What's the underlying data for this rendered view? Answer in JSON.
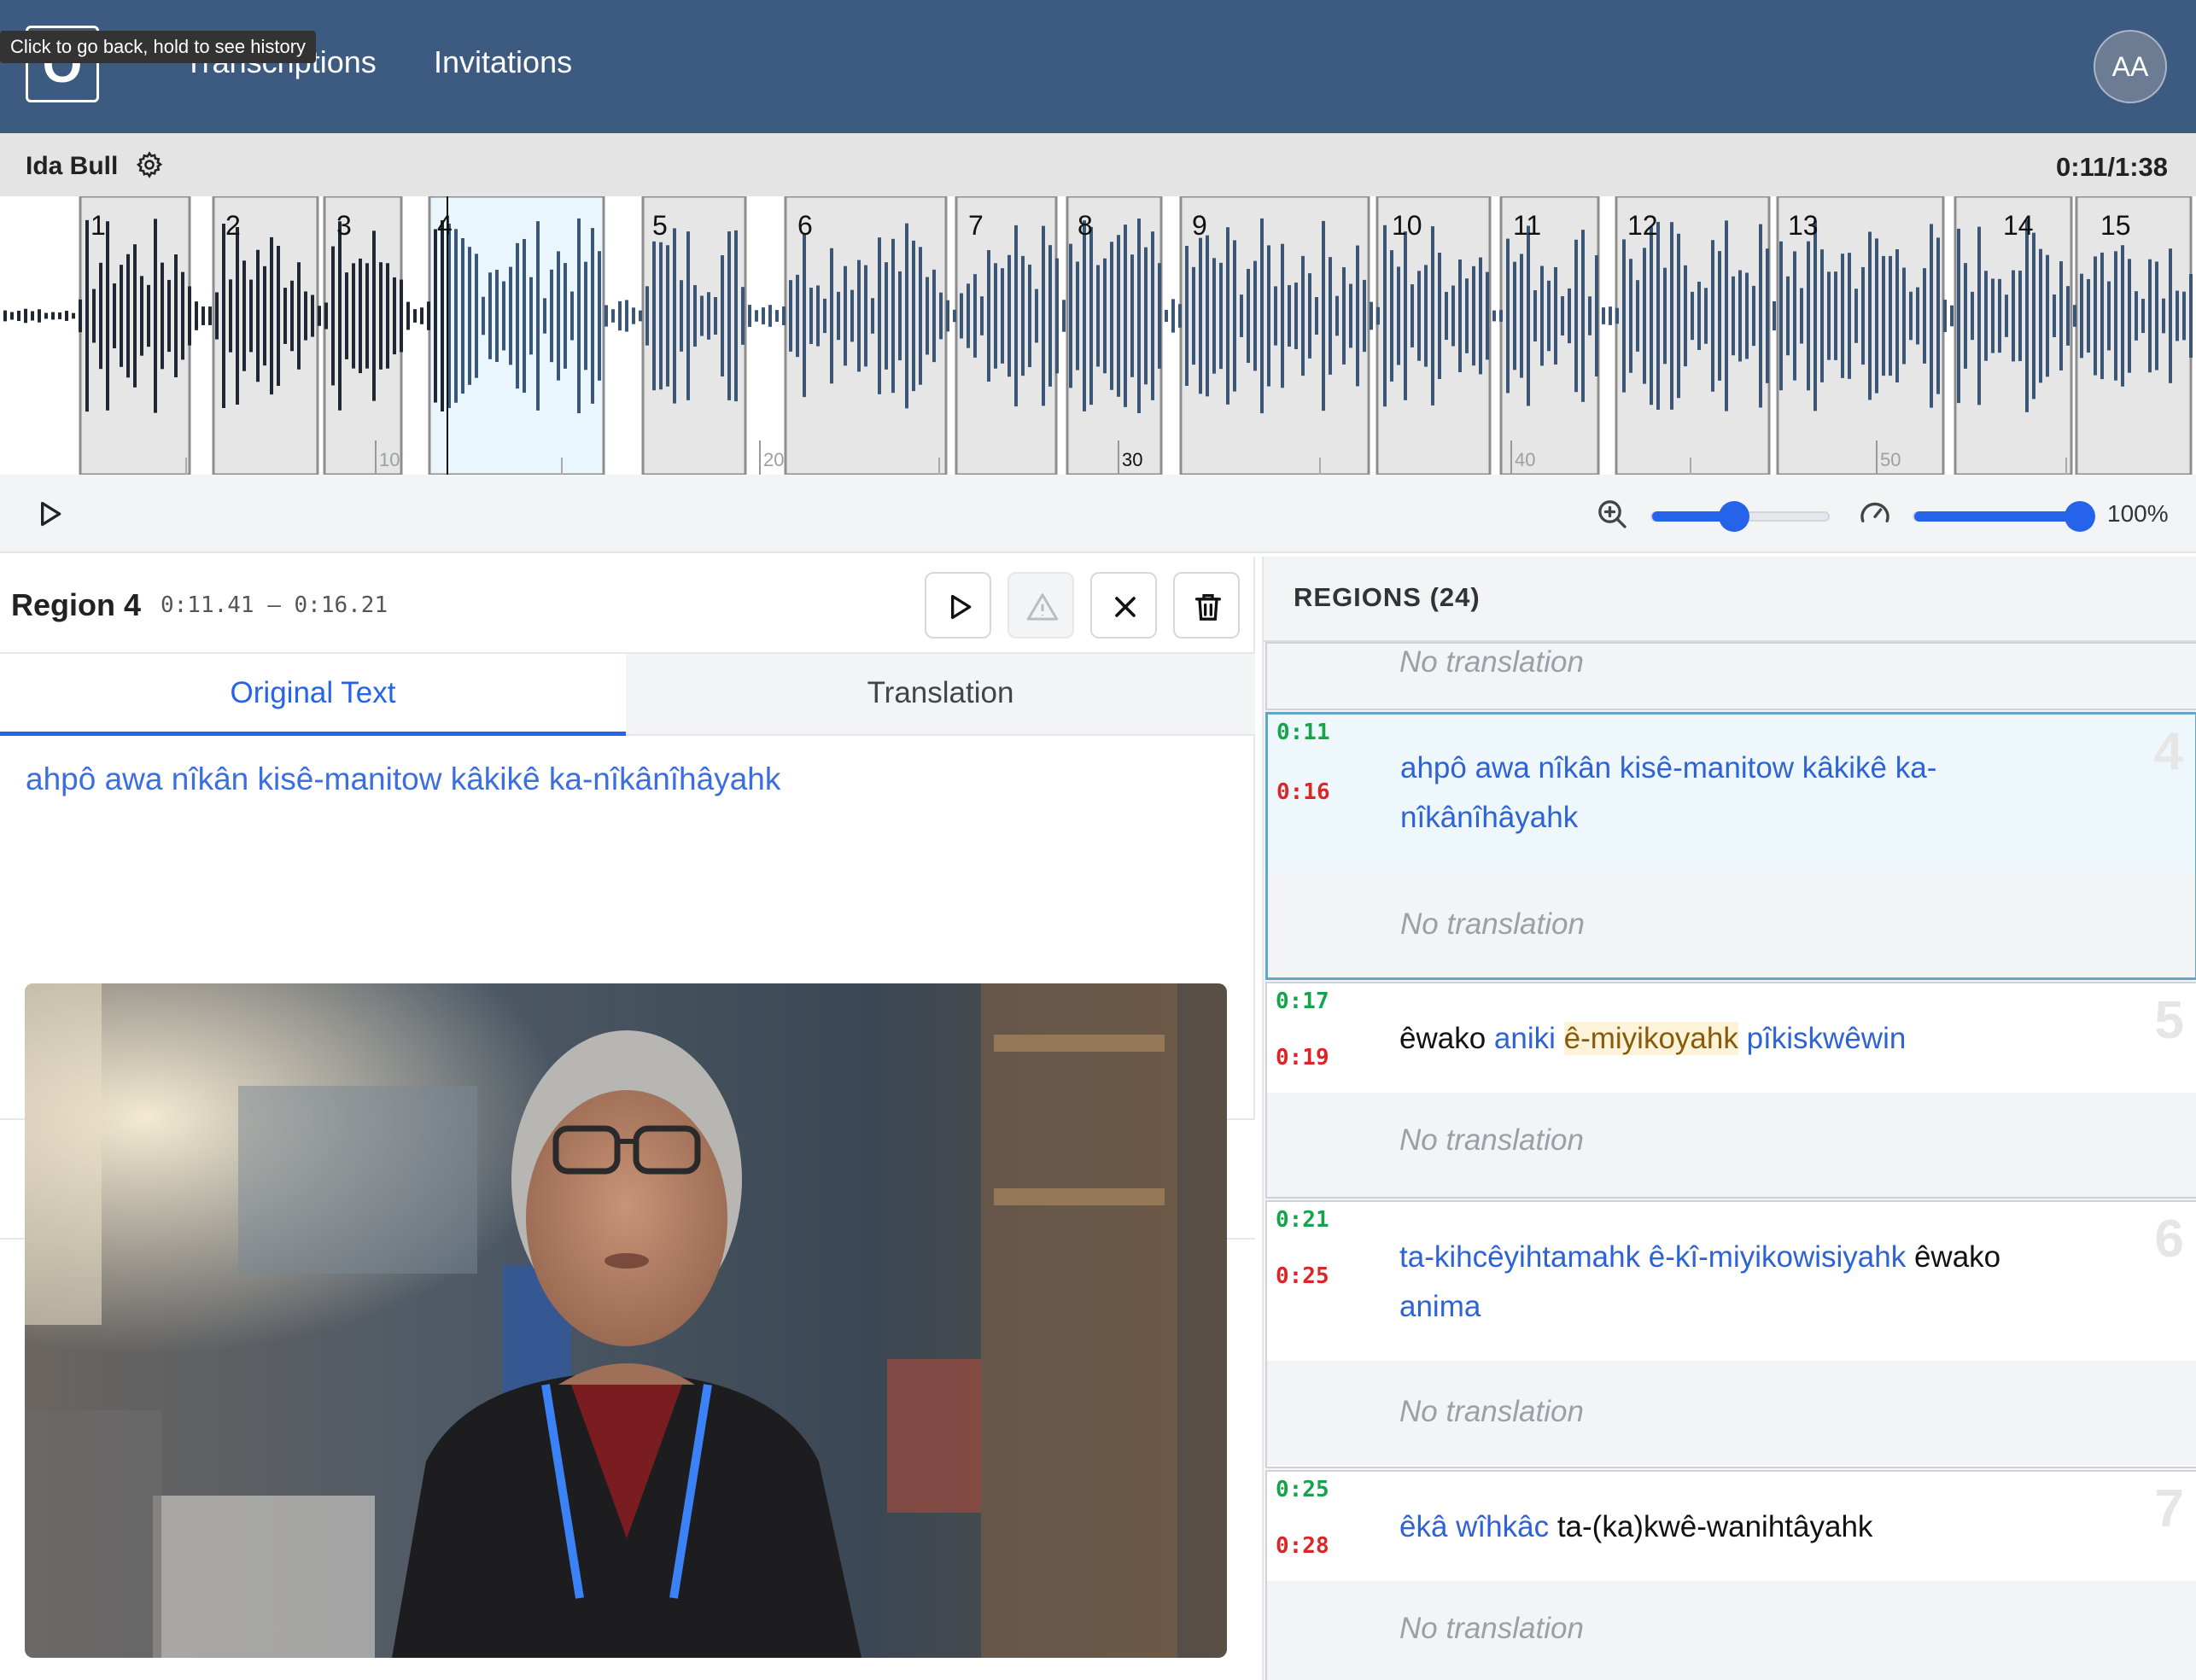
{
  "nav": {
    "logo": "O",
    "links": [
      "Transcriptions",
      "Invitations"
    ],
    "tooltip": "Click to go back, hold to see history",
    "avatar": "AA"
  },
  "info": {
    "speaker": "Ida Bull",
    "time": "0:11/1:38"
  },
  "waveform": {
    "region_numbers": [
      "1",
      "2",
      "3",
      "4",
      "5",
      "6",
      "7",
      "8",
      "9",
      "10",
      "11",
      "12",
      "13",
      "14",
      "15"
    ],
    "time_ticks": [
      "10",
      "20",
      "30",
      "40",
      "50"
    ]
  },
  "controls": {
    "zoom_level": 0.45,
    "speed_value": "100%"
  },
  "editor": {
    "region_title": "Region 4",
    "region_range": "0:11.41 – 0:16.21",
    "tabs": [
      "Original Text",
      "Translation"
    ],
    "original_text": "ahpô awa nîkân kisê-manitow kâkikê ka-nîkânîhâyahk"
  },
  "regions": {
    "title": "REGIONS (24)",
    "partial_translation": "No translation",
    "items": [
      {
        "start": "0:11",
        "end": "0:16",
        "num": "4",
        "line1": "ahpô awa nîkân kisê-manitow kâkikê ka-",
        "line2": "nîkânîhâyahk",
        "translation": "No translation"
      },
      {
        "start": "0:17",
        "end": "0:19",
        "num": "5",
        "w1": "êwako",
        "w2": "aniki",
        "w3": "ê-miyikoyahk",
        "w4": "pîkiskwêwin",
        "translation": "No translation"
      },
      {
        "start": "0:21",
        "end": "0:25",
        "num": "6",
        "w1": "ta-kihcêyihtamahk ê-kî-miyikowisiyahk",
        "w2": "êwako",
        "w3": "anima",
        "translation": "No translation"
      },
      {
        "start": "0:25",
        "end": "0:28",
        "num": "7",
        "w1": "êkâ wîhkâc",
        "w2": "ta-(ka)kwê-wanihtâyahk",
        "translation": "No translation"
      }
    ]
  },
  "colors": {
    "nav": "#3d5a80",
    "accent": "#2563eb",
    "start_time": "#16a34a",
    "end_time": "#dc2626",
    "selected_border": "#5fa8c7"
  },
  "icons": [
    "gear-icon",
    "play-icon",
    "zoom-in-icon",
    "speedometer-icon",
    "warning-icon",
    "close-icon",
    "trash-icon"
  ]
}
